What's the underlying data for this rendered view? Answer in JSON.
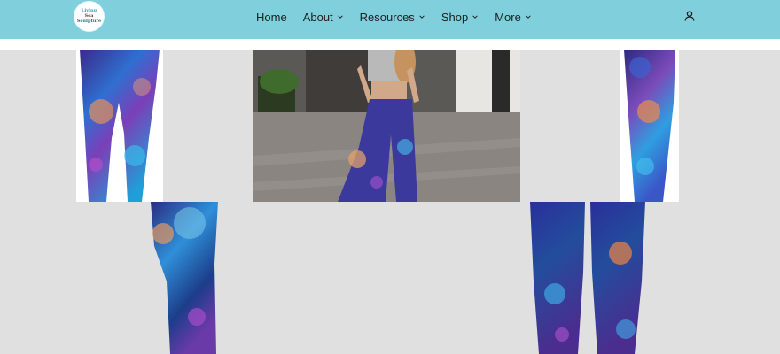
{
  "brand": {
    "logo_lines": [
      "Living",
      "Sea",
      "Sculpture"
    ],
    "colors": {
      "header_bg": "#7fd0dc",
      "gallery_bg": "#e0e0e0",
      "text": "#1e1e1e"
    }
  },
  "nav": {
    "items": [
      {
        "label": "Home",
        "has_dropdown": false
      },
      {
        "label": "About",
        "has_dropdown": true
      },
      {
        "label": "Resources",
        "has_dropdown": true
      },
      {
        "label": "Shop",
        "has_dropdown": true
      },
      {
        "label": "More",
        "has_dropdown": true
      }
    ],
    "account_icon": "user-icon"
  },
  "gallery": {
    "images": [
      "leggings-front-view",
      "model-wearing-leggings-street",
      "leggings-side-view",
      "leggings-back-left-closeup",
      "leggings-back-right-closeup"
    ]
  }
}
